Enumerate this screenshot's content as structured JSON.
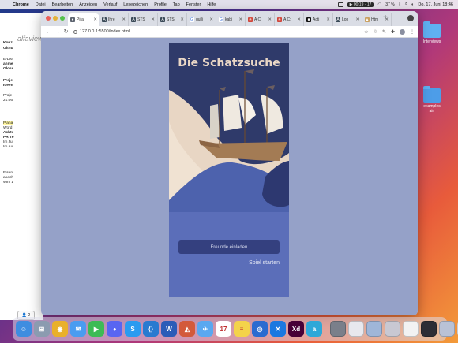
{
  "menubar": {
    "app": "Chrome",
    "items": [
      "Datei",
      "Bearbeiten",
      "Anzeigen",
      "Verlauf",
      "Lesezeichen",
      "Profile",
      "Tab",
      "Fenster",
      "Hilfe"
    ],
    "recording": "00:19",
    "recording_extra": "17",
    "battery": "37 %",
    "clock": "Do. 17. Juni 18:46"
  },
  "background_app": {
    "logo": "alfaview",
    "lines": [
      "Konz",
      "Githu",
      "E-Lea",
      "anme",
      "Gloss",
      "Proje",
      "Ideen",
      "Proje",
      "21.06",
      "Plana",
      "Word",
      "Achte",
      "PR-Te",
      "Im Ju",
      "Im Au",
      "Eisen",
      "anach",
      "vom 1"
    ],
    "badge": "2"
  },
  "desktop": {
    "icon1_label": "Interviews",
    "icon2_label": "-examples-\nain"
  },
  "chrome": {
    "tabs": [
      {
        "title": "Pira",
        "color": "#5d6470",
        "glyph": "●"
      },
      {
        "title": "Ihre",
        "color": "#3a4a58",
        "glyph": "A"
      },
      {
        "title": "STS",
        "color": "#3a4a58",
        "glyph": "A"
      },
      {
        "title": "STS",
        "color": "#3a4a58",
        "glyph": "A"
      },
      {
        "title": "gulli",
        "color": "#ffffff",
        "glyph": "G"
      },
      {
        "title": "kabi",
        "color": "#ffffff",
        "glyph": "G"
      },
      {
        "title": "A C:",
        "color": "#d0463a",
        "glyph": "✳"
      },
      {
        "title": "A C:",
        "color": "#d0463a",
        "glyph": "✳"
      },
      {
        "title": "Acti",
        "color": "#111111",
        "glyph": "■"
      },
      {
        "title": "Lon",
        "color": "#3a4a58",
        "glyph": "A"
      },
      {
        "title": "Htm",
        "color": "#c9a060",
        "glyph": "▲"
      }
    ],
    "url": "127.0.0.1:5500/index.html",
    "new_tab": "+"
  },
  "game": {
    "title": "Die Schatzsuche",
    "invite_button": "Freunde einladen",
    "start_link": "Spiel starten"
  },
  "dock": {
    "apps": [
      {
        "name": "finder",
        "color": "#3f8de0",
        "glyph": "☺"
      },
      {
        "name": "launchpad",
        "color": "#8b9bb0",
        "glyph": "⊞"
      },
      {
        "name": "chrome",
        "color": "#e9b02c",
        "glyph": "◉"
      },
      {
        "name": "mail",
        "color": "#4a9cf0",
        "glyph": "✉"
      },
      {
        "name": "facetime",
        "color": "#3dbb55",
        "glyph": "▶"
      },
      {
        "name": "discord",
        "color": "#5865f2",
        "glyph": "◕"
      },
      {
        "name": "skype",
        "color": "#2a9bf0",
        "glyph": "S"
      },
      {
        "name": "vscode",
        "color": "#2a7ad0",
        "glyph": "⟨⟩"
      },
      {
        "name": "word",
        "color": "#2b5cb8",
        "glyph": "W"
      },
      {
        "name": "affinity",
        "color": "#d35a3b",
        "glyph": "◭"
      },
      {
        "name": "testflight",
        "color": "#5aa8f0",
        "glyph": "✈"
      },
      {
        "name": "calendar",
        "color": "#ffffff",
        "glyph": "17"
      },
      {
        "name": "notes",
        "color": "#f4d34a",
        "glyph": "≡"
      },
      {
        "name": "sourcetree",
        "color": "#2a6bd0",
        "glyph": "◎"
      },
      {
        "name": "xcode",
        "color": "#1b78e0",
        "glyph": "✕"
      },
      {
        "name": "adobe-xd",
        "color": "#470137",
        "glyph": "Xd"
      },
      {
        "name": "alfaview",
        "color": "#2ea8d8",
        "glyph": "a"
      }
    ],
    "recent": [
      {
        "name": "window-1",
        "color": "#7a7f8a"
      },
      {
        "name": "window-2",
        "color": "#e8e8ee"
      },
      {
        "name": "window-3",
        "color": "#9fb6d8"
      },
      {
        "name": "window-4",
        "color": "#c8c8d2"
      },
      {
        "name": "window-5",
        "color": "#f2f2f2"
      },
      {
        "name": "window-6",
        "color": "#2d2d35"
      },
      {
        "name": "window-7",
        "color": "#b9c2d6"
      }
    ]
  }
}
